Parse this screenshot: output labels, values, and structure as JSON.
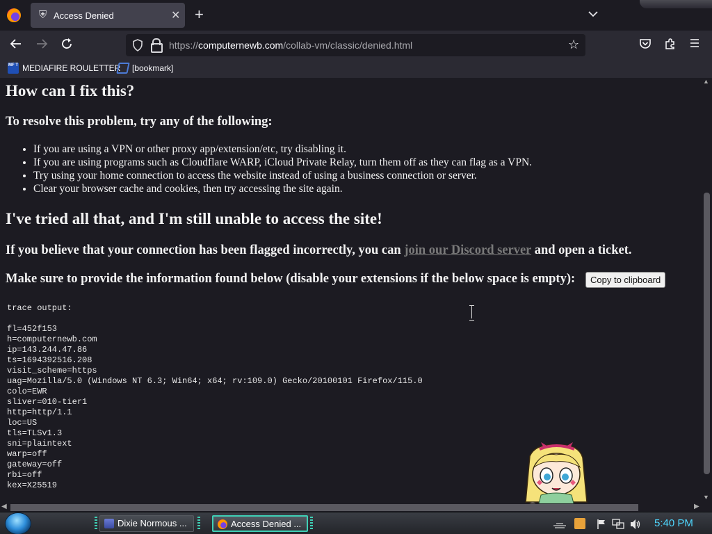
{
  "browser": {
    "tab": {
      "title": "Access Denied",
      "icon": "puzzle-shield-icon"
    },
    "url": {
      "scheme": "https://",
      "host": "computernewb.com",
      "path": "/collab-vm/classic/denied.html"
    },
    "bookmarks": [
      {
        "label": "MEDIAFIRE ROULETTER",
        "favicon": "MF T"
      },
      {
        "label": "[bookmark]",
        "favicon": "chevron-bookmark-icon"
      }
    ]
  },
  "page": {
    "fix_heading": "How can I fix this?",
    "resolve_heading": "To resolve this problem, try any of the following:",
    "tips": [
      "If you are using a VPN or other proxy app/extension/etc, try disabling it.",
      "If you are using programs such as Cloudflare WARP, iCloud Private Relay, turn them off as they can flag as a VPN.",
      "Try using your home connection to access the website instead of using a business connection or server.",
      "Clear your browser cache and cookies, then try accessing the site again."
    ],
    "tried_heading": "I've tried all that, and I'm still unable to access the site!",
    "flagged_before": "If you believe that your connection has been flagged incorrectly, you can ",
    "flagged_link": "join our Discord server",
    "flagged_after": " and open a ticket.",
    "provide_text": "Make sure to provide the information found below (disable your extensions if the below space is empty):",
    "copy_button": "Copy to clipboard",
    "trace_lines": [
      "trace output:",
      "",
      "fl=452f153",
      "h=computernewb.com",
      "ip=143.244.47.86",
      "ts=1694392516.208",
      "visit_scheme=https",
      "uag=Mozilla/5.0 (Windows NT 6.3; Win64; x64; rv:109.0) Gecko/20100101 Firefox/115.0",
      "colo=EWR",
      "sliver=010-tier1",
      "http=http/1.1",
      "loc=US",
      "tls=TLSv1.3",
      "sni=plaintext",
      "warp=off",
      "gateway=off",
      "rbi=off",
      "kex=X25519"
    ]
  },
  "taskbar": {
    "tasks": [
      {
        "label": "Dixie Normous ...",
        "icon": "window-icon",
        "active": false
      },
      {
        "label": "Access Denied ...",
        "icon": "firefox-icon",
        "active": true
      }
    ],
    "clock": "5:40 PM"
  },
  "colors": {
    "page_bg": "#1c1b22",
    "toolbar_bg": "#2b2a33",
    "link_gray": "#7a7a7a",
    "clock_blue": "#4fd7ff",
    "task_active_border": "#3fd0b6"
  }
}
